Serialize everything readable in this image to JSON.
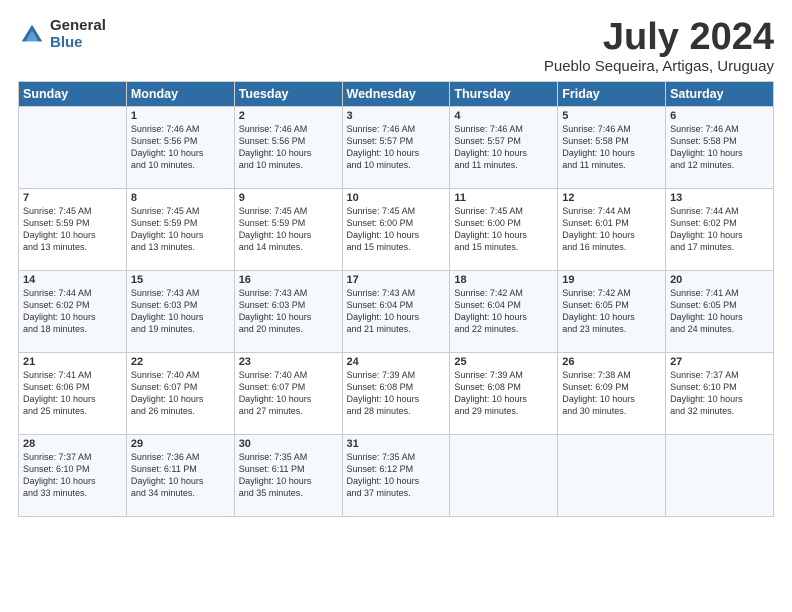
{
  "header": {
    "logo_general": "General",
    "logo_blue": "Blue",
    "title": "July 2024",
    "subtitle": "Pueblo Sequeira, Artigas, Uruguay"
  },
  "days_of_week": [
    "Sunday",
    "Monday",
    "Tuesday",
    "Wednesday",
    "Thursday",
    "Friday",
    "Saturday"
  ],
  "weeks": [
    [
      {
        "day": "",
        "info": ""
      },
      {
        "day": "1",
        "info": "Sunrise: 7:46 AM\nSunset: 5:56 PM\nDaylight: 10 hours\nand 10 minutes."
      },
      {
        "day": "2",
        "info": "Sunrise: 7:46 AM\nSunset: 5:56 PM\nDaylight: 10 hours\nand 10 minutes."
      },
      {
        "day": "3",
        "info": "Sunrise: 7:46 AM\nSunset: 5:57 PM\nDaylight: 10 hours\nand 10 minutes."
      },
      {
        "day": "4",
        "info": "Sunrise: 7:46 AM\nSunset: 5:57 PM\nDaylight: 10 hours\nand 11 minutes."
      },
      {
        "day": "5",
        "info": "Sunrise: 7:46 AM\nSunset: 5:58 PM\nDaylight: 10 hours\nand 11 minutes."
      },
      {
        "day": "6",
        "info": "Sunrise: 7:46 AM\nSunset: 5:58 PM\nDaylight: 10 hours\nand 12 minutes."
      }
    ],
    [
      {
        "day": "7",
        "info": "Sunrise: 7:45 AM\nSunset: 5:59 PM\nDaylight: 10 hours\nand 13 minutes."
      },
      {
        "day": "8",
        "info": "Sunrise: 7:45 AM\nSunset: 5:59 PM\nDaylight: 10 hours\nand 13 minutes."
      },
      {
        "day": "9",
        "info": "Sunrise: 7:45 AM\nSunset: 5:59 PM\nDaylight: 10 hours\nand 14 minutes."
      },
      {
        "day": "10",
        "info": "Sunrise: 7:45 AM\nSunset: 6:00 PM\nDaylight: 10 hours\nand 15 minutes."
      },
      {
        "day": "11",
        "info": "Sunrise: 7:45 AM\nSunset: 6:00 PM\nDaylight: 10 hours\nand 15 minutes."
      },
      {
        "day": "12",
        "info": "Sunrise: 7:44 AM\nSunset: 6:01 PM\nDaylight: 10 hours\nand 16 minutes."
      },
      {
        "day": "13",
        "info": "Sunrise: 7:44 AM\nSunset: 6:02 PM\nDaylight: 10 hours\nand 17 minutes."
      }
    ],
    [
      {
        "day": "14",
        "info": "Sunrise: 7:44 AM\nSunset: 6:02 PM\nDaylight: 10 hours\nand 18 minutes."
      },
      {
        "day": "15",
        "info": "Sunrise: 7:43 AM\nSunset: 6:03 PM\nDaylight: 10 hours\nand 19 minutes."
      },
      {
        "day": "16",
        "info": "Sunrise: 7:43 AM\nSunset: 6:03 PM\nDaylight: 10 hours\nand 20 minutes."
      },
      {
        "day": "17",
        "info": "Sunrise: 7:43 AM\nSunset: 6:04 PM\nDaylight: 10 hours\nand 21 minutes."
      },
      {
        "day": "18",
        "info": "Sunrise: 7:42 AM\nSunset: 6:04 PM\nDaylight: 10 hours\nand 22 minutes."
      },
      {
        "day": "19",
        "info": "Sunrise: 7:42 AM\nSunset: 6:05 PM\nDaylight: 10 hours\nand 23 minutes."
      },
      {
        "day": "20",
        "info": "Sunrise: 7:41 AM\nSunset: 6:05 PM\nDaylight: 10 hours\nand 24 minutes."
      }
    ],
    [
      {
        "day": "21",
        "info": "Sunrise: 7:41 AM\nSunset: 6:06 PM\nDaylight: 10 hours\nand 25 minutes."
      },
      {
        "day": "22",
        "info": "Sunrise: 7:40 AM\nSunset: 6:07 PM\nDaylight: 10 hours\nand 26 minutes."
      },
      {
        "day": "23",
        "info": "Sunrise: 7:40 AM\nSunset: 6:07 PM\nDaylight: 10 hours\nand 27 minutes."
      },
      {
        "day": "24",
        "info": "Sunrise: 7:39 AM\nSunset: 6:08 PM\nDaylight: 10 hours\nand 28 minutes."
      },
      {
        "day": "25",
        "info": "Sunrise: 7:39 AM\nSunset: 6:08 PM\nDaylight: 10 hours\nand 29 minutes."
      },
      {
        "day": "26",
        "info": "Sunrise: 7:38 AM\nSunset: 6:09 PM\nDaylight: 10 hours\nand 30 minutes."
      },
      {
        "day": "27",
        "info": "Sunrise: 7:37 AM\nSunset: 6:10 PM\nDaylight: 10 hours\nand 32 minutes."
      }
    ],
    [
      {
        "day": "28",
        "info": "Sunrise: 7:37 AM\nSunset: 6:10 PM\nDaylight: 10 hours\nand 33 minutes."
      },
      {
        "day": "29",
        "info": "Sunrise: 7:36 AM\nSunset: 6:11 PM\nDaylight: 10 hours\nand 34 minutes."
      },
      {
        "day": "30",
        "info": "Sunrise: 7:35 AM\nSunset: 6:11 PM\nDaylight: 10 hours\nand 35 minutes."
      },
      {
        "day": "31",
        "info": "Sunrise: 7:35 AM\nSunset: 6:12 PM\nDaylight: 10 hours\nand 37 minutes."
      },
      {
        "day": "",
        "info": ""
      },
      {
        "day": "",
        "info": ""
      },
      {
        "day": "",
        "info": ""
      }
    ]
  ]
}
